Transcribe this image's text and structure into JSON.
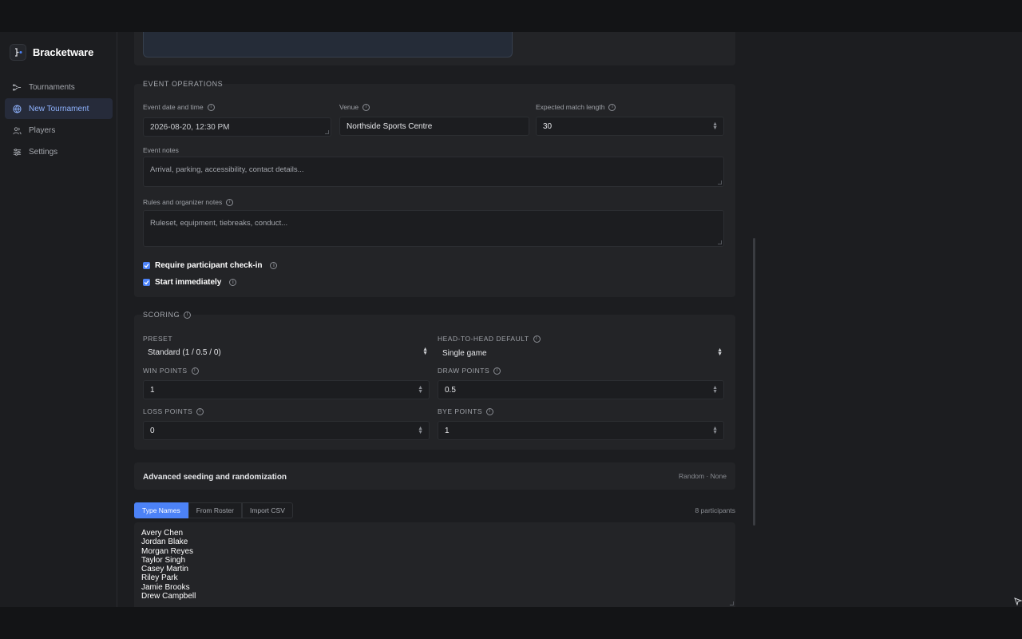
{
  "brand": {
    "name": "Bracketware"
  },
  "nav": [
    {
      "label": "Tournaments",
      "icon": "tournaments-icon"
    },
    {
      "label": "New Tournament",
      "icon": "globe-icon",
      "active": true
    },
    {
      "label": "Players",
      "icon": "players-icon"
    },
    {
      "label": "Settings",
      "icon": "settings-icon"
    }
  ],
  "event_ops": {
    "title": "Event Operations",
    "date_label": "Event date and time",
    "date_value": "2026-08-20, 12:30 PM",
    "venue_label": "Venue",
    "venue_value": "Northside Sports Centre",
    "match_length_label": "Expected match length",
    "match_length_value": "30",
    "notes_label": "Event notes",
    "notes_placeholder": "Arrival, parking, accessibility, contact details...",
    "rules_label": "Rules and organizer notes",
    "rules_placeholder": "Ruleset, equipment, tiebreaks, conduct...",
    "checkin_label": "Require participant check-in",
    "checkin_checked": true,
    "start_label": "Start immediately",
    "start_checked": true
  },
  "scoring": {
    "title": "Scoring",
    "preset_label": "Preset",
    "preset_value": "Standard (1 / 0.5 / 0)",
    "h2h_label": "Head-to-head default",
    "h2h_value": "Single game",
    "win_label": "Win points",
    "win_value": "1",
    "draw_label": "Draw points",
    "draw_value": "0.5",
    "loss_label": "Loss points",
    "loss_value": "0",
    "bye_label": "Bye points",
    "bye_value": "1"
  },
  "advanced": {
    "title": "Advanced seeding and randomization",
    "meta": "Random · None"
  },
  "participants": {
    "tabs": [
      "Type Names",
      "From Roster",
      "Import CSV"
    ],
    "active_tab": "Type Names",
    "count_label": "8 participants",
    "names": [
      "Avery Chen",
      "Jordan Blake",
      "Morgan Reyes",
      "Taylor Singh",
      "Casey Martin",
      "Riley Park",
      "Jamie Brooks",
      "Drew Campbell"
    ]
  },
  "colors": {
    "accent": "#4c82f7",
    "background": "#1c1d20",
    "card": "#232427"
  }
}
